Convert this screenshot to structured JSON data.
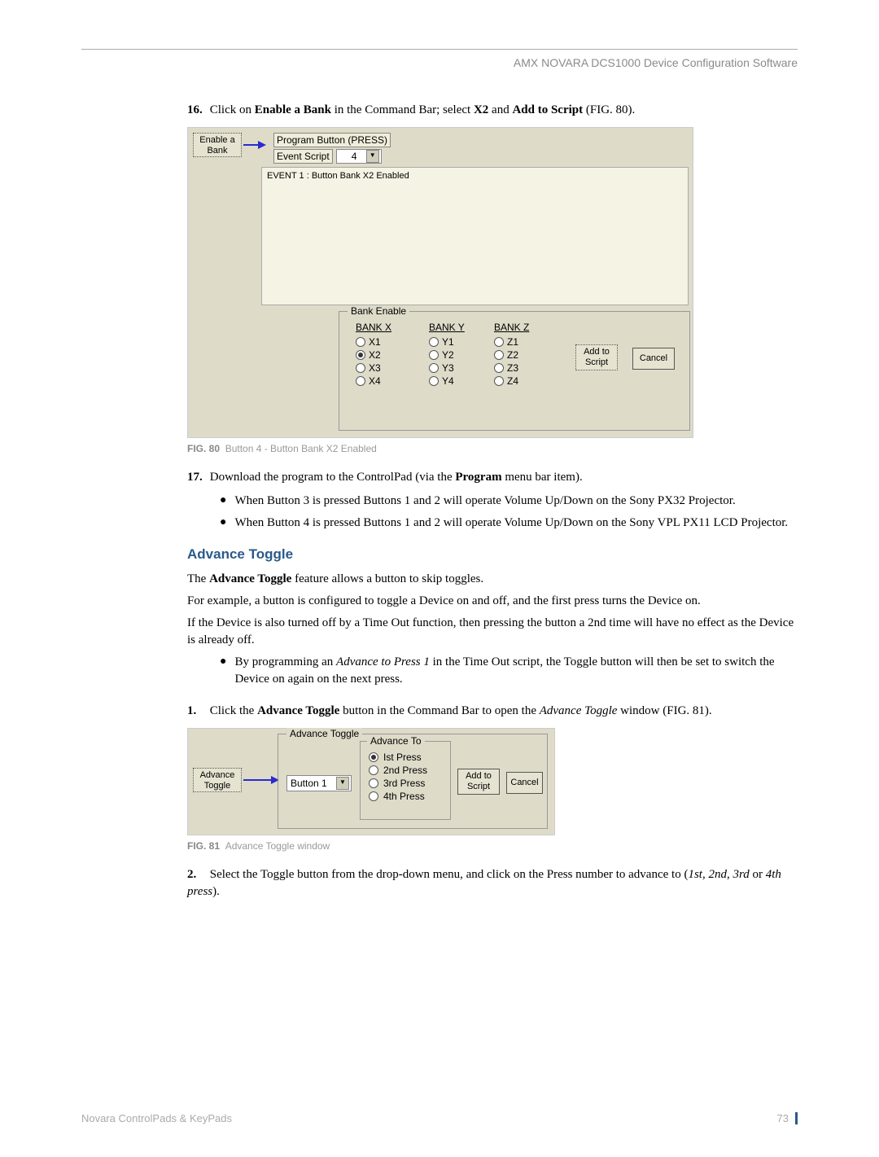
{
  "header": "AMX NOVARA DCS1000 Device Configuration Software",
  "step16": {
    "num": "16.",
    "t1": "Click on ",
    "b1": "Enable a Bank",
    "t2": " in the Command Bar; select ",
    "b2": "X2",
    "t3": " and ",
    "b3": "Add to Script",
    "t4": " (FIG. 80)."
  },
  "fig80": {
    "enable_bank_l1": "Enable a",
    "enable_bank_l2": "Bank",
    "program_button": "Program Button (PRESS)",
    "event_script_label": "Event Script",
    "event_script_value": "4",
    "list_line": "EVENT 1  : Button Bank X2 Enabled",
    "group_label": "Bank Enable",
    "bankX": {
      "hdr": "BANK X",
      "r": [
        "X1",
        "X2",
        "X3",
        "X4"
      ],
      "selected": 1
    },
    "bankY": {
      "hdr": "BANK Y",
      "r": [
        "Y1",
        "Y2",
        "Y3",
        "Y4"
      ],
      "selected": -1
    },
    "bankZ": {
      "hdr": "BANK Z",
      "r": [
        "Z1",
        "Z2",
        "Z3",
        "Z4"
      ],
      "selected": -1
    },
    "add_l1": "Add to",
    "add_l2": "Script",
    "cancel": "Cancel"
  },
  "fig80_caption": {
    "num": "FIG. 80",
    "txt": "Button 4 - Button Bank X2 Enabled"
  },
  "step17": {
    "num": "17.",
    "t1": "Download the program to the ControlPad (via the ",
    "b1": "Program",
    "t2": " menu bar item)."
  },
  "bullets17": [
    "When Button 3 is pressed Buttons 1 and 2 will operate Volume Up/Down on the Sony PX32 Projector.",
    "When Button 4 is pressed Buttons 1 and 2 will operate Volume Up/Down on the Sony VPL PX11 LCD Projector."
  ],
  "section_title": "Advance Toggle",
  "para1": {
    "t1": "The ",
    "b1": "Advance Toggle",
    "t2": " feature allows a button to skip toggles."
  },
  "para2": "For example, a button is configured to toggle a Device on and off, and the first press turns the Device on.",
  "para3": "If the Device is also turned off by a Time Out function, then pressing the button a 2nd time will have no effect as the Device is already off.",
  "bullet_adv": {
    "t1": "By programming an ",
    "i1": "Advance to Press 1",
    "t2": " in the Time Out script, the Toggle button will then be set to switch the Device on again on the next press."
  },
  "step1": {
    "num": "1.",
    "t1": "Click the ",
    "b1": "Advance Toggle",
    "t2": " button in the Command Bar to open the ",
    "i1": "Advance Toggle",
    "t3": " window (FIG. 81)."
  },
  "fig81": {
    "btn_l1": "Advance",
    "btn_l2": "Toggle",
    "group_label": "Advance Toggle",
    "dropdown": "Button 1",
    "advto_label": "Advance To",
    "presses": [
      "Ist Press",
      "2nd Press",
      "3rd Press",
      "4th Press"
    ],
    "selected": 0,
    "add_l1": "Add to",
    "add_l2": "Script",
    "cancel": "Cancel"
  },
  "fig81_caption": {
    "num": "FIG. 81",
    "txt": "Advance Toggle window"
  },
  "step2": {
    "num": "2.",
    "t1": "Select the Toggle button from the drop-down menu, and click on the Press number to advance to (",
    "i1": "1st",
    "t2": ", ",
    "i2": "2nd",
    "t3": ", ",
    "i3": "3rd",
    "t4": " or ",
    "i4": "4th press",
    "t5": ")."
  },
  "footer_left": "Novara ControlPads   & KeyPads",
  "footer_page": "73"
}
